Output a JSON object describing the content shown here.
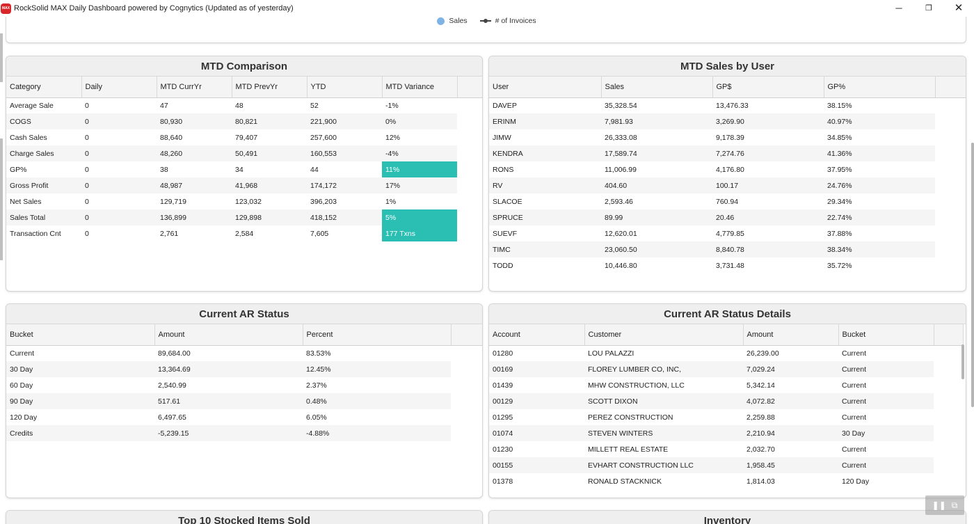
{
  "window": {
    "title": "RockSolid MAX Daily Dashboard powered by Cognytics (Updated as of yesterday)",
    "icon_text": "MAX",
    "controls": {
      "minimize": "─",
      "maximize": "❐",
      "close": "✕"
    }
  },
  "chart_legend": {
    "sales_label": "Sales",
    "invoices_label": "# of Invoices",
    "colors": {
      "sales": "#7fb3e6",
      "invoices": "#444444"
    }
  },
  "mtd_comparison": {
    "title": "MTD Comparison",
    "columns": [
      "Category",
      "Daily",
      "MTD CurrYr",
      "MTD PrevYr",
      "YTD",
      "MTD Variance"
    ],
    "rows": [
      [
        "Average Sale",
        "0",
        "47",
        "48",
        "52",
        "-1%"
      ],
      [
        "COGS",
        "0",
        "80,930",
        "80,821",
        "221,900",
        "0%"
      ],
      [
        "Cash Sales",
        "0",
        "88,640",
        "79,407",
        "257,600",
        "12%"
      ],
      [
        "Charge Sales",
        "0",
        "48,260",
        "50,491",
        "160,553",
        "-4%"
      ],
      [
        "GP%",
        "0",
        "38",
        "34",
        "44",
        "11%"
      ],
      [
        "Gross Profit",
        "0",
        "48,987",
        "41,968",
        "174,172",
        "17%"
      ],
      [
        "Net Sales",
        "0",
        "129,719",
        "123,032",
        "396,203",
        "1%"
      ],
      [
        "Sales Total",
        "0",
        "136,899",
        "129,898",
        "418,152",
        "5%"
      ],
      [
        "Transaction Cnt",
        "0",
        "2,761",
        "2,584",
        "7,605",
        "177 Txns"
      ]
    ],
    "highlight_rows": [
      4,
      7,
      8
    ],
    "highlight_color": "#2bbfb3"
  },
  "mtd_sales_by_user": {
    "title": "MTD Sales by User",
    "columns": [
      "User",
      "Sales",
      "GP$",
      "GP%"
    ],
    "rows": [
      [
        "DAVEP",
        "35,328.54",
        "13,476.33",
        "38.15%"
      ],
      [
        "ERINM",
        "7,981.93",
        "3,269.90",
        "40.97%"
      ],
      [
        "JIMW",
        "26,333.08",
        "9,178.39",
        "34.85%"
      ],
      [
        "KENDRA",
        "17,589.74",
        "7,274.76",
        "41.36%"
      ],
      [
        "RONS",
        "11,006.99",
        "4,176.80",
        "37.95%"
      ],
      [
        "RV",
        "404.60",
        "100.17",
        "24.76%"
      ],
      [
        "SLACOE",
        "2,593.46",
        "760.94",
        "29.34%"
      ],
      [
        "SPRUCE",
        "89.99",
        "20.46",
        "22.74%"
      ],
      [
        "SUEVF",
        "12,620.01",
        "4,779.85",
        "37.88%"
      ],
      [
        "TIMC",
        "23,060.50",
        "8,840.78",
        "38.34%"
      ],
      [
        "TODD",
        "10,446.80",
        "3,731.48",
        "35.72%"
      ]
    ]
  },
  "ar_status": {
    "title": "Current AR Status",
    "columns": [
      "Bucket",
      "Amount",
      "Percent"
    ],
    "rows": [
      [
        "Current",
        "89,684.00",
        "83.53%"
      ],
      [
        "30 Day",
        "13,364.69",
        "12.45%"
      ],
      [
        "60 Day",
        "2,540.99",
        "2.37%"
      ],
      [
        "90 Day",
        "517.61",
        "0.48%"
      ],
      [
        "120 Day",
        "6,497.65",
        "6.05%"
      ],
      [
        "Credits",
        "-5,239.15",
        "-4.88%"
      ]
    ]
  },
  "ar_details": {
    "title": "Current AR Status Details",
    "columns": [
      "Account",
      "Customer",
      "Amount",
      "Bucket"
    ],
    "rows": [
      [
        "01280",
        "LOU PALAZZI",
        "26,239.00",
        "Current"
      ],
      [
        "00169",
        "FLOREY LUMBER CO, INC,",
        "7,029.24",
        "Current"
      ],
      [
        "01439",
        "MHW CONSTRUCTION, LLC",
        "5,342.14",
        "Current"
      ],
      [
        "00129",
        "SCOTT DIXON",
        "4,072.82",
        "Current"
      ],
      [
        "01295",
        "PEREZ CONSTRUCTION",
        "2,259.88",
        "Current"
      ],
      [
        "01074",
        "STEVEN WINTERS",
        "2,210.94",
        "30 Day"
      ],
      [
        "01230",
        "MILLETT REAL ESTATE",
        "2,032.70",
        "Current"
      ],
      [
        "00155",
        "EVHART CONSTRUCTION LLC",
        "1,958.45",
        "Current"
      ],
      [
        "01378",
        "RONALD STACKNICK",
        "1,814.03",
        "120 Day"
      ]
    ]
  },
  "bottom_panels": {
    "top10_title": "Top 10 Stocked Items Sold",
    "inventory_title": "Inventory"
  },
  "media_controls": {
    "pause": "❚❚",
    "pip": "⧉"
  }
}
